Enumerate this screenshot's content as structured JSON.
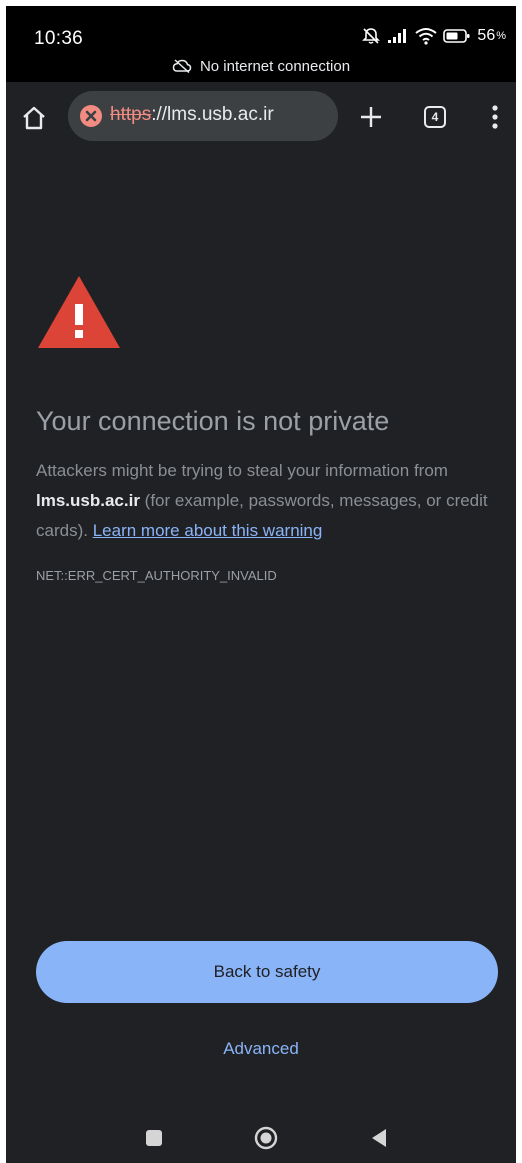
{
  "status_bar": {
    "time": "10:36",
    "battery": "56",
    "offline_notice": "No internet connection"
  },
  "toolbar": {
    "url_scheme": "https",
    "url_rest": "://lms.usb.ac.ir",
    "tab_count": "4"
  },
  "interstitial": {
    "heading": "Your connection is not private",
    "explanation_before": "Attackers might be trying to steal your information from",
    "host": "lms.usb.ac.ir",
    "explanation_after": "(for example, passwords, messages, or credit cards).",
    "learn_more": "Learn more about this warning",
    "error_code": "NET::ERR_CERT_AUTHORITY_INVALID",
    "back_button": "Back to safety",
    "advanced_link": "Advanced"
  },
  "colors": {
    "background": "#202124",
    "accent": "#8ab4f8",
    "warning": "#db4437",
    "error_scheme": "#f28b82"
  }
}
